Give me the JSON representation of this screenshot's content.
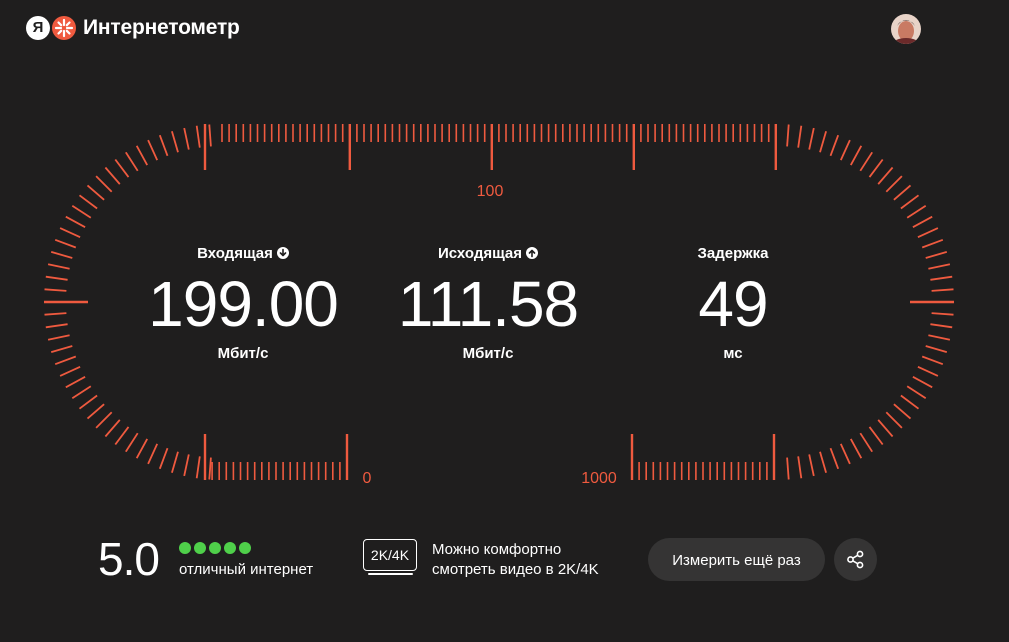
{
  "header": {
    "logo_letter": "Я",
    "title": "Интернетометр"
  },
  "gauge": {
    "accent_color": "#ef5a3f",
    "scale_labels": {
      "top": "100",
      "bottom_left": "0",
      "bottom_right": "1000"
    }
  },
  "metrics": {
    "download": {
      "label": "Входящая",
      "icon": "arrow-down-icon",
      "value": "199.00",
      "unit": "Мбит/с"
    },
    "upload": {
      "label": "Исходящая",
      "icon": "arrow-up-icon",
      "value": "111.58",
      "unit": "Мбит/с"
    },
    "latency": {
      "label": "Задержка",
      "value": "49",
      "unit": "мс"
    }
  },
  "rating": {
    "score": "5.0",
    "dots_filled": 5,
    "dots_total": 5,
    "dot_color": "#4fcf4a",
    "text": "отличный интернет"
  },
  "quality": {
    "badge": "2K/4K",
    "line1": "Можно комфортно",
    "line2": "смотреть видео в 2K/4K"
  },
  "actions": {
    "retry_label": "Измерить ещё раз",
    "share_icon": "share-icon"
  }
}
